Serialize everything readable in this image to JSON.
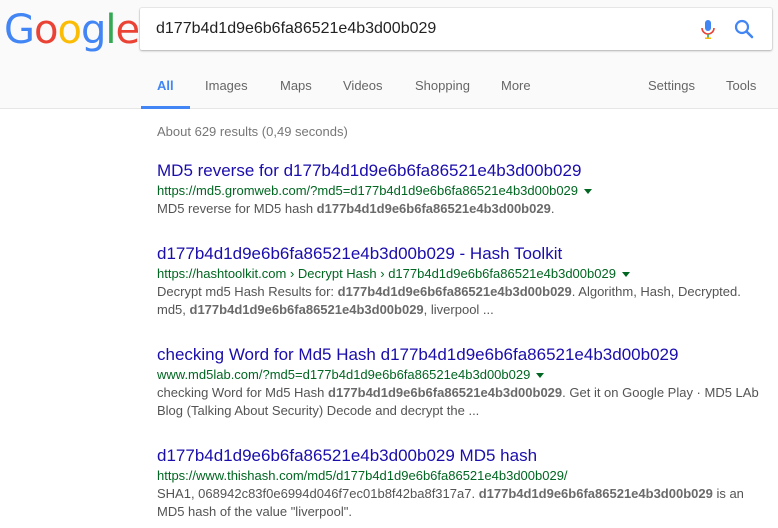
{
  "logo": {
    "letters": [
      "G",
      "o",
      "o",
      "g",
      "l",
      "e"
    ],
    "colors": [
      "#4285F4",
      "#EA4335",
      "#FBBC05",
      "#4285F4",
      "#34A853",
      "#EA4335"
    ]
  },
  "search": {
    "query": "d177b4d1d9e6b6fa86521e4b3d00b029",
    "mic_icon": "microphone-icon",
    "search_icon": "magnifier-icon"
  },
  "tabs": [
    {
      "label": "All",
      "active": true
    },
    {
      "label": "Images"
    },
    {
      "label": "Maps"
    },
    {
      "label": "Videos"
    },
    {
      "label": "Shopping"
    },
    {
      "label": "More"
    },
    {
      "label": "Settings"
    },
    {
      "label": "Tools"
    }
  ],
  "stats": "About 629 results (0,49 seconds)",
  "results": [
    {
      "title": "MD5 reverse for d177b4d1d9e6b6fa86521e4b3d00b029",
      "url": "https://md5.gromweb.com/?md5=d177b4d1d9e6b6fa86521e4b3d00b029",
      "has_caret": true,
      "snippet": [
        {
          "text": "MD5 reverse for MD5 hash "
        },
        {
          "text": "d177b4d1d9e6b6fa86521e4b3d00b029",
          "bold": true
        },
        {
          "text": "."
        }
      ]
    },
    {
      "title": "d177b4d1d9e6b6fa86521e4b3d00b029 - Hash Toolkit",
      "url": "https://hashtoolkit.com › Decrypt Hash › d177b4d1d9e6b6fa86521e4b3d00b029",
      "has_caret": true,
      "snippet": [
        {
          "text": "Decrypt md5 Hash Results for: "
        },
        {
          "text": "d177b4d1d9e6b6fa86521e4b3d00b029",
          "bold": true
        },
        {
          "text": ". Algorithm, Hash, Decrypted. md5, "
        },
        {
          "text": "d177b4d1d9e6b6fa86521e4b3d00b029",
          "bold": true
        },
        {
          "text": ", liverpool ..."
        }
      ]
    },
    {
      "title": "checking Word for Md5 Hash d177b4d1d9e6b6fa86521e4b3d00b029",
      "url": "www.md5lab.com/?md5=d177b4d1d9e6b6fa86521e4b3d00b029",
      "has_caret": true,
      "snippet": [
        {
          "text": "checking Word for Md5 Hash "
        },
        {
          "text": "d177b4d1d9e6b6fa86521e4b3d00b029",
          "bold": true
        },
        {
          "text": ". Get it on Google Play · MD5 LAb Blog (Talking About Security) Decode and decrypt the ..."
        }
      ]
    },
    {
      "title": "d177b4d1d9e6b6fa86521e4b3d00b029 MD5 hash",
      "url": "https://www.thishash.com/md5/d177b4d1d9e6b6fa86521e4b3d00b029/",
      "has_caret": false,
      "snippet": [
        {
          "text": "SHA1, 068942c83f0e6994d046f7ec01b8f42ba8f317a7. "
        },
        {
          "text": "d177b4d1d9e6b6fa86521e4b3d00b029",
          "bold": true
        },
        {
          "text": " is an MD5 hash of the value \"liverpool\"."
        }
      ]
    }
  ]
}
